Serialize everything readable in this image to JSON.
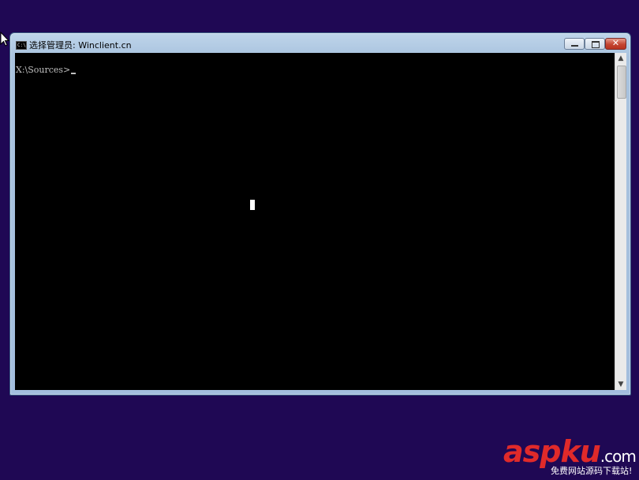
{
  "window": {
    "title": "选择管理员: Winclient.cn",
    "icon": "cmd-icon"
  },
  "console": {
    "prompt": "X:\\Sources>"
  },
  "watermark": {
    "logo": "aspku",
    "suffix": ".com",
    "tagline": "免费网站源码下载站!"
  },
  "colors": {
    "desktop": "#1f0854",
    "console_bg": "#000000",
    "console_text": "#c0c0c0",
    "close_button": "#c44532"
  }
}
